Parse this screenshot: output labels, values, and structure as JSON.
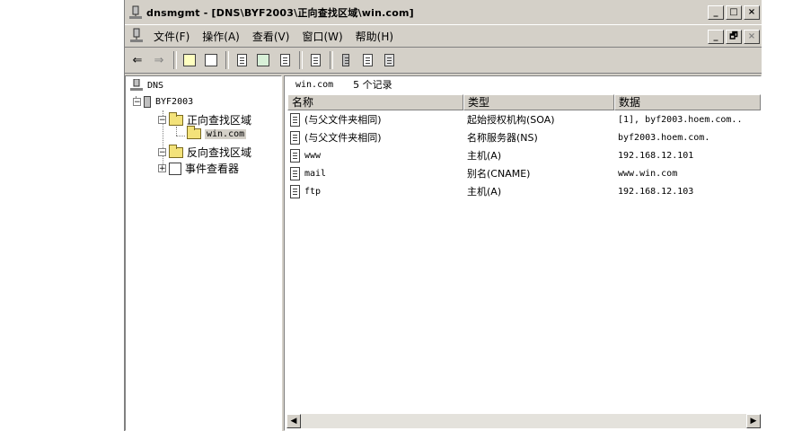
{
  "window": {
    "title": "dnsmgmt - [DNS\\BYF2003\\正向查找区域\\win.com]",
    "controls": [
      "_",
      "□",
      "×"
    ]
  },
  "menubar": {
    "items": [
      "文件(F)",
      "操作(A)",
      "查看(V)",
      "窗口(W)",
      "帮助(H)"
    ],
    "mdi_controls": [
      "_",
      "🗗",
      "×"
    ]
  },
  "toolbar": {
    "back": "⇐",
    "forward": "⇒"
  },
  "tree": {
    "root": "DNS",
    "server": "BYF2003",
    "forward_zones": "正向查找区域",
    "zone": "win.com",
    "reverse_zones": "反向查找区域",
    "event_viewer": "事件查看器",
    "expanders": {
      "minus": "−",
      "plus": "+"
    }
  },
  "details": {
    "zone_name": "win.com",
    "record_count": "5 个记录",
    "columns": [
      "名称",
      "类型",
      "数据"
    ],
    "rows": [
      {
        "name": "(与父文件夹相同)",
        "type": "起始授权机构(SOA)",
        "data": "[1], byf2003.hoem.com.."
      },
      {
        "name": "(与父文件夹相同)",
        "type": "名称服务器(NS)",
        "data": "byf2003.hoem.com."
      },
      {
        "name": "www",
        "type": "主机(A)",
        "data": "192.168.12.101"
      },
      {
        "name": "mail",
        "type": "别名(CNAME)",
        "data": "www.win.com"
      },
      {
        "name": "ftp",
        "type": "主机(A)",
        "data": "192.168.12.103"
      }
    ],
    "scroll_left": "◀",
    "scroll_right": "▶"
  }
}
